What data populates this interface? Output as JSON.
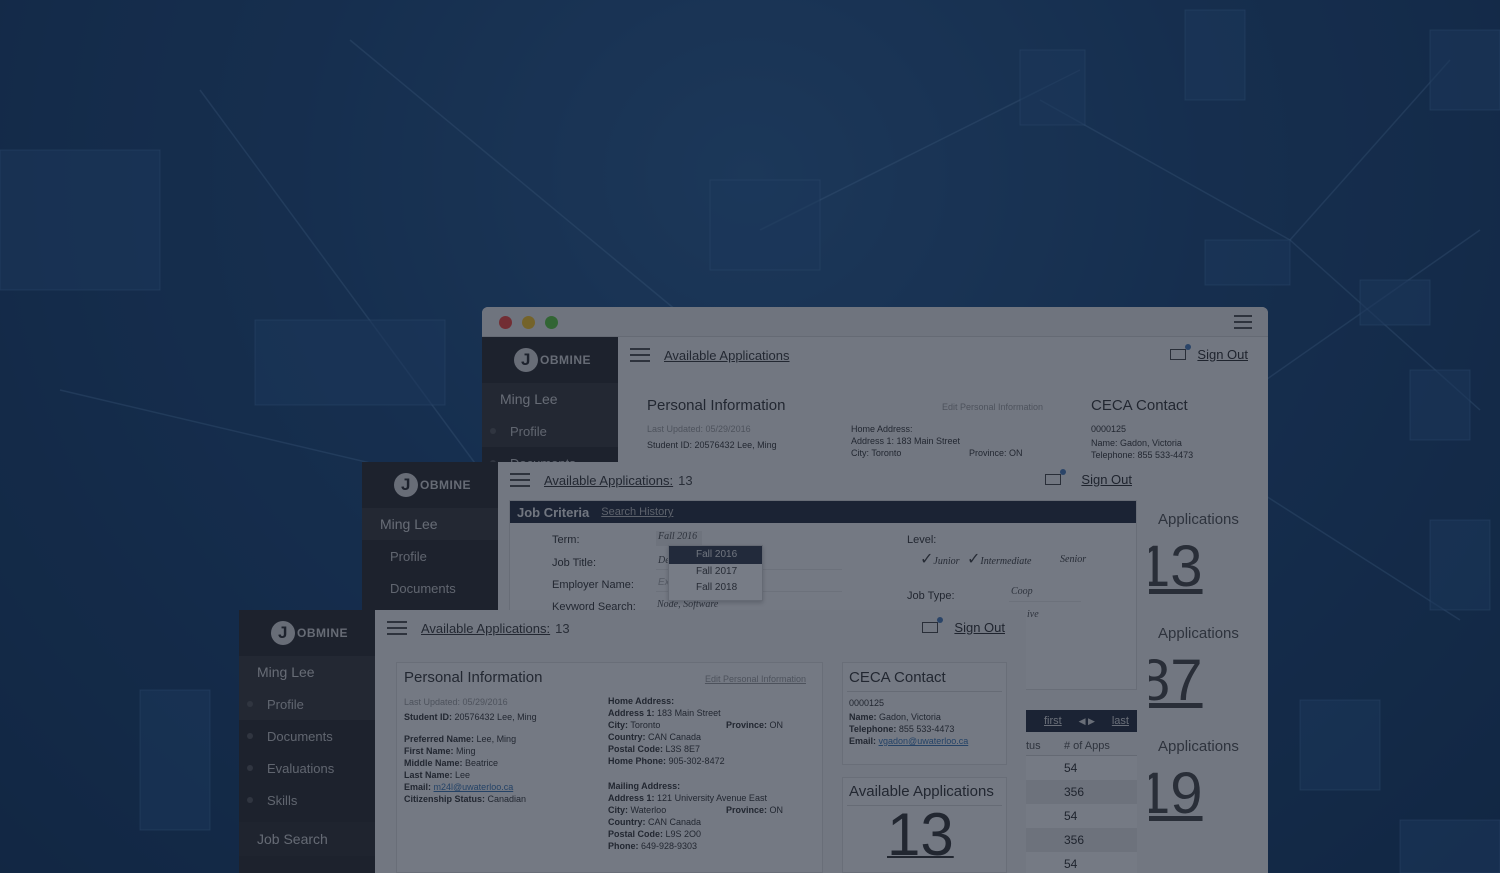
{
  "brand": {
    "letter": "J",
    "name": "OBMINE"
  },
  "sidebar": {
    "user": "Ming Lee",
    "items": [
      "Profile",
      "Documents",
      "Evaluations",
      "Skills"
    ],
    "section": "Job Search"
  },
  "header": {
    "available_link": "Available Applications:",
    "available_count": "13",
    "sign_out": "Sign Out"
  },
  "back_window": {
    "title": "Available Applications",
    "sign_out": "Sign Out",
    "personal_title": "Personal Information",
    "edit_link": "Edit Personal Information",
    "last_updated": "Last Updated: 05/29/2016",
    "student_id": "Student ID: 20576432    Lee, Ming",
    "home_address_label": "Home Address:",
    "address1": "Address 1: 183 Main Street",
    "city": "City: Toronto",
    "province": "Province: ON",
    "ceca_title": "CECA Contact",
    "ceca_id": "0000125",
    "ceca_name": "Name: Gadon, Victoria",
    "ceca_phone": "Telephone: 855 533-4473",
    "right_labels": [
      "Applications",
      "Applications",
      "Applications"
    ],
    "right_numbers": [
      "13",
      "87",
      "19"
    ]
  },
  "job_criteria": {
    "title": "Job Criteria",
    "search_history": "Search History",
    "term_label": "Term:",
    "term_value": "Fall 2016",
    "term_options": [
      "Fall 2016",
      "Fall 2017",
      "Fall 2018"
    ],
    "job_title_label": "Job Title:",
    "job_title_value": "De",
    "employer_label": "Employer Name:",
    "employer_value": "Ex",
    "keyword_label": "Keyword Search:",
    "keyword_value": "Node, Software",
    "level_label": "Level:",
    "levels": [
      "Junior",
      "Intermediate",
      "Senior"
    ],
    "job_type_label": "Job Type:",
    "job_type_value": "Coop",
    "extra_value": "ive",
    "pager": {
      "first": "first",
      "last": "last"
    },
    "table_headers": [
      "tus",
      "# of Apps"
    ],
    "table_values": [
      "54",
      "356",
      "54",
      "356",
      "54"
    ]
  },
  "personal": {
    "title": "Personal Information",
    "edit": "Edit Personal Information",
    "last_updated": "Last Updated: 05/29/2016",
    "student_id_label": "Student ID:",
    "student_id_value": "20576432    Lee, Ming",
    "preferred": [
      "Preferred Name:",
      "Lee, Ming"
    ],
    "first": [
      "First Name:",
      "Ming"
    ],
    "middle": [
      "Middle Name:",
      "Beatrice"
    ],
    "last": [
      "Last Name:",
      "Lee"
    ],
    "email": [
      "Email:",
      "m24l@uwaterloo.ca"
    ],
    "citizenship": [
      "Citizenship Status:",
      "Canadian"
    ],
    "home_label": "Home Address:",
    "home_address1": [
      "Address 1:",
      "183 Main Street"
    ],
    "home_city": [
      "City:",
      "Toronto"
    ],
    "home_province": [
      "Province:",
      "ON"
    ],
    "home_country": [
      "Country:",
      "CAN Canada"
    ],
    "home_postal": [
      "Postal Code:",
      "L3S 8E7"
    ],
    "home_phone": [
      "Home Phone:",
      "905-302-8472"
    ],
    "mail_label": "Mailing Address:",
    "mail_address1": [
      "Address 1:",
      "121 University Avenue East"
    ],
    "mail_city": [
      "City:",
      "Waterloo"
    ],
    "mail_province": [
      "Province:",
      "ON"
    ],
    "mail_country": [
      "Country:",
      "CAN Canada"
    ],
    "mail_postal": [
      "Postal Code:",
      "L9S 2O0"
    ],
    "mail_phone": [
      "Phone:",
      "649-928-9303"
    ]
  },
  "ceca": {
    "title": "CECA Contact",
    "id": "0000125",
    "name": [
      "Name:",
      "Gadon, Victoria"
    ],
    "phone": [
      "Telephone:",
      "855 533-4473"
    ],
    "email": [
      "Email:",
      "vgadon@uwaterloo.ca"
    ]
  },
  "available": {
    "title": "Available Applications",
    "count": "13"
  },
  "colors": {
    "sidebar": "#2f2f31",
    "navy_bar": "#2c3240",
    "link": "#3f77b0"
  }
}
